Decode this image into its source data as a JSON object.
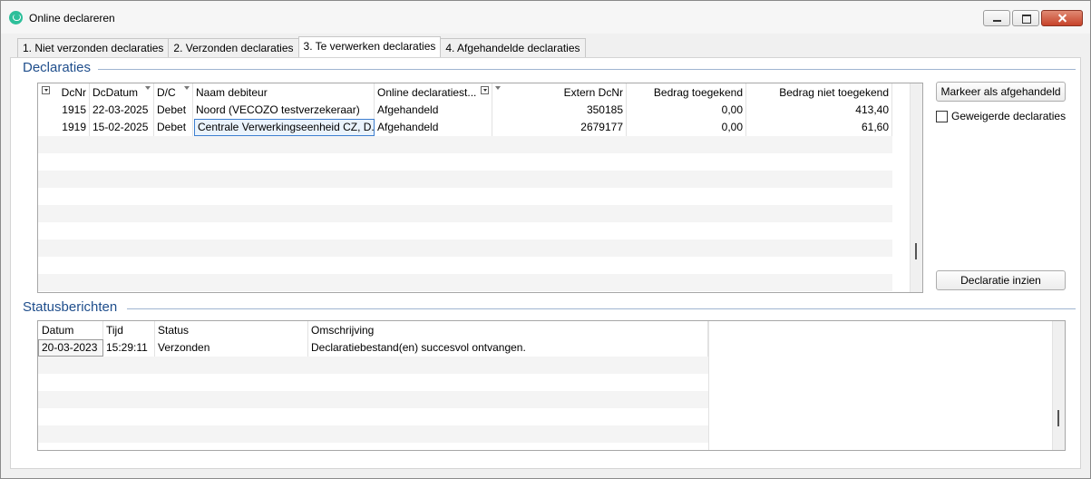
{
  "window": {
    "title": "Online declareren"
  },
  "tabs": [
    {
      "label": "1. Niet verzonden declaraties"
    },
    {
      "label": "2. Verzonden declaraties"
    },
    {
      "label": "3. Te verwerken declaraties"
    },
    {
      "label": "4. Afgehandelde declaraties"
    }
  ],
  "declaraties": {
    "heading": "Declaraties",
    "columns": {
      "dcnr": "DcNr",
      "dcdatum": "DcDatum",
      "dc": "D/C",
      "naam": "Naam debiteur",
      "online": "Online declaratiest...",
      "extern": "Extern DcNr",
      "toegekend": "Bedrag toegekend",
      "niet_toegekend": "Bedrag niet toegekend"
    },
    "rows": [
      {
        "dcnr": "1915",
        "dcdatum": "22-03-2025",
        "dc": "Debet",
        "naam": "Noord (VECOZO testverzekeraar)",
        "online": "Afgehandeld",
        "extern": "350185",
        "toegekend": "0,00",
        "niet_toegekend": "413,40"
      },
      {
        "dcnr": "1919",
        "dcdatum": "15-02-2025",
        "dc": "Debet",
        "naam": "Centrale Verwerkingseenheid CZ, D...",
        "online": "Afgehandeld",
        "extern": "2679177",
        "toegekend": "0,00",
        "niet_toegekend": "61,60"
      }
    ]
  },
  "actions": {
    "markeer": "Markeer als afgehandeld",
    "geweigerde": "Geweigerde declaraties",
    "geweigerde_checked": false,
    "inzien": "Declaratie inzien"
  },
  "status": {
    "heading": "Statusberichten",
    "columns": {
      "datum": "Datum",
      "tijd": "Tijd",
      "status": "Status",
      "omschrijving": "Omschrijving"
    },
    "rows": [
      {
        "datum": "20-03-2023",
        "tijd": "15:29:11",
        "status": "Verzonden",
        "omschrijving": "Declaratiebestand(en) succesvol ontvangen."
      }
    ]
  }
}
